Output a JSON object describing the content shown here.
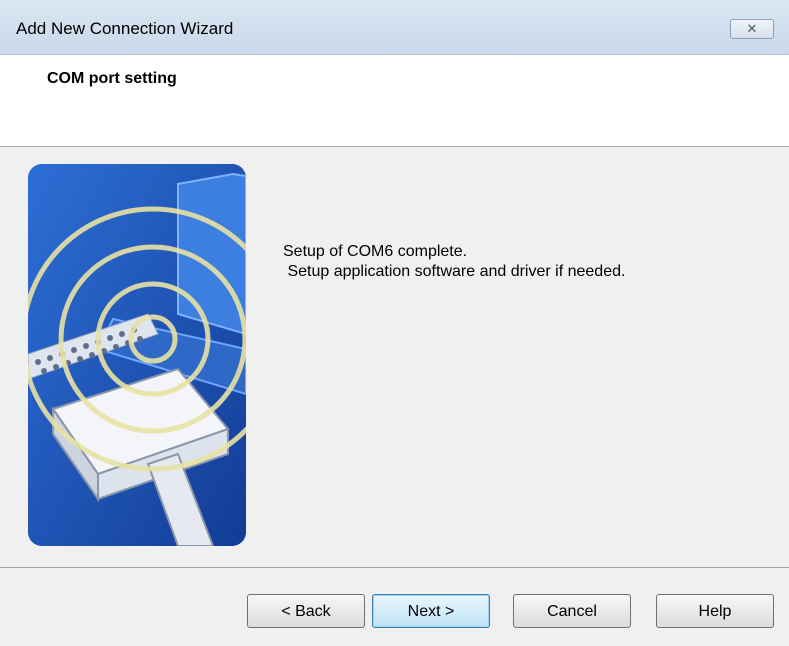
{
  "window": {
    "title": "Add New Connection Wizard",
    "close_symbol": "✕"
  },
  "header": {
    "title": "COM port setting"
  },
  "main": {
    "message_line1": "Setup of COM6 complete.",
    "message_line2": " Setup application software and driver if needed.",
    "illustration": "serial-connector-wireless-illustration"
  },
  "footer": {
    "back_label": "< Back",
    "next_label": "Next >",
    "cancel_label": "Cancel",
    "help_label": "Help"
  },
  "colors": {
    "accent": "#3c7fb1",
    "illustration_blue": "#1f53b8",
    "ring": "#e8e2a4"
  }
}
